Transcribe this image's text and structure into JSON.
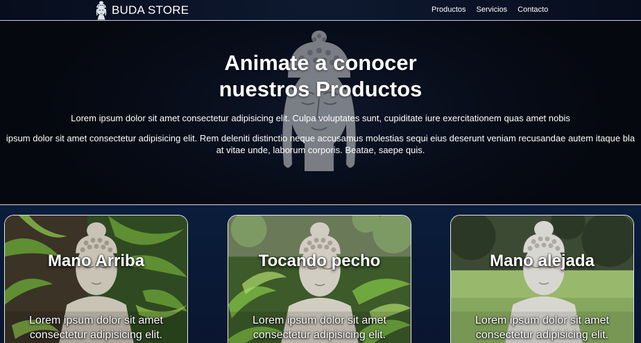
{
  "navbar": {
    "brand": "BUDA STORE",
    "links": [
      "Productos",
      "Servicios",
      "Contacto"
    ]
  },
  "hero": {
    "title_line1": "Animate a conocer",
    "title_line2": "nuestros Productos",
    "paragraph1": "Lorem ipsum dolor sit amet consectetur adipisicing elit. Culpa voluptates sunt, cupiditate iure exercitationem quas amet nobis",
    "paragraph2_line1": "ipsum dolor sit amet consectetur adipisicing elit. Rem deleniti distinctio neque accusamus molestias sequi eius deserunt veniam recusandae autem itaque bla",
    "paragraph2_line2": "at vitae unde, laborum corporis. Beatae, saepe quis."
  },
  "cards": [
    {
      "title": "Mano Arriba",
      "text_line1": "Lorem ipsum dolor sit amet",
      "text_line2": "consectetur adipisicing elit."
    },
    {
      "title": "Tocando pecho",
      "text_line1": "Lorem ipsum dolor sit amet",
      "text_line2": "consectetur adipisicing elit."
    },
    {
      "title": "Mano alejada",
      "text_line1": "Lorem ipsum dolor sit amet",
      "text_line2": "consectetur adipisicing elit."
    }
  ],
  "icons": {
    "brand": "buddha-head-icon",
    "hero_background": "buddha-head-icon"
  },
  "colors": {
    "navbar_bg": "#0a1224",
    "hero_bg": "#070c18",
    "cards_section_bg": "#0b1d3c",
    "text": "#ffffff",
    "border": "#e8e8e8"
  }
}
